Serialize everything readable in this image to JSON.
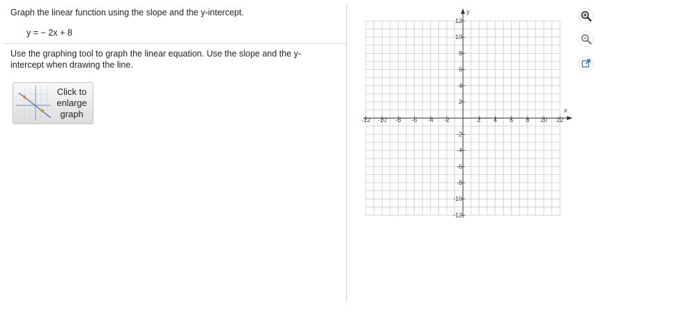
{
  "question": {
    "instruction": "Graph the linear function using the slope and the y-intercept.",
    "equation": "y = − 2x + 8",
    "tool_instruction": "Use the graphing tool to graph the linear equation. Use the slope and the y-intercept when drawing the line."
  },
  "enlarge_button": {
    "line1": "Click to",
    "line2": "enlarge",
    "line3": "graph"
  },
  "graph": {
    "x_axis_label": "x",
    "y_axis_label": "y",
    "x_ticks": [
      "-12",
      "-10",
      "-8",
      "-6",
      "-4",
      "-2",
      "2",
      "4",
      "6",
      "8",
      "10",
      "12"
    ],
    "y_ticks": [
      "12",
      "10",
      "8",
      "6",
      "4",
      "2",
      "-2",
      "-4",
      "-6",
      "-8",
      "-10",
      "-12"
    ]
  },
  "toolbar": {
    "icons": [
      "zoom-in-icon",
      "zoom-out-icon",
      "popout-icon"
    ]
  }
}
